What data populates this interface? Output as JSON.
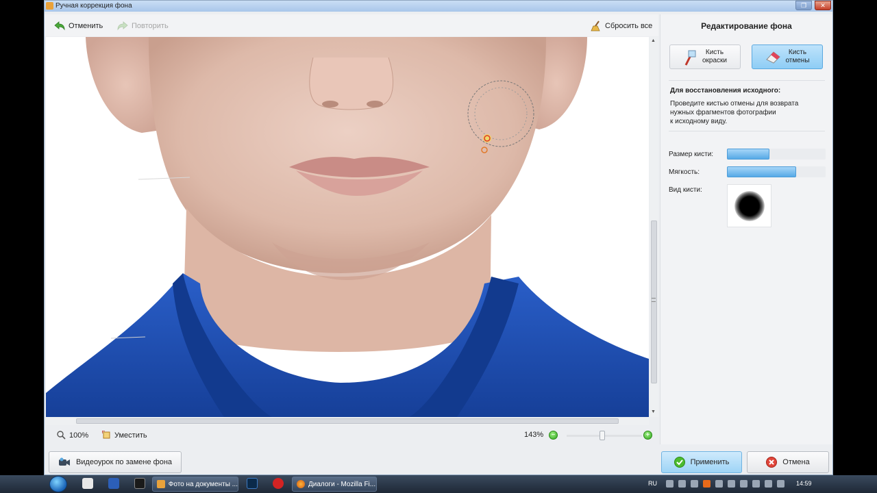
{
  "window": {
    "title": "Ручная коррекция фона"
  },
  "toolbar": {
    "undo_label": "Отменить",
    "redo_label": "Повторить",
    "reset_label": "Сбросить все"
  },
  "status": {
    "zoom_100_label": "100%",
    "fit_label": "Уместить",
    "zoom_value": "143%",
    "zoom_level_percent": 45
  },
  "panel": {
    "title": "Редактирование фона",
    "brush_paint_label": "Кисть\nокраски",
    "brush_undo_label": "Кисть\nотмены",
    "active_brush": "brush_undo",
    "restore_title": "Для восстановления исходного:",
    "restore_text": "Проведите кистью отмены для возврата\nнужных фрагментов фотографии\nк исходному виду.",
    "brush_size_label": "Размер кисти:",
    "brush_size_percent": 43,
    "softness_label": "Мягкость:",
    "softness_percent": 70,
    "brush_type_label": "Вид кисти:"
  },
  "buttons": {
    "video_label": "Видеоурок по замене фона",
    "apply_label": "Применить",
    "cancel_label": "Отмена"
  },
  "taskbar": {
    "task1_label": "Фото на документы ...",
    "task2_label": "Диалоги - Mozilla Fi...",
    "lang": "RU",
    "clock": "14:59"
  },
  "colors": {
    "accent": "#8ecdf5",
    "shirt": "#1f4fb0",
    "skin": "#e6c2b3"
  }
}
